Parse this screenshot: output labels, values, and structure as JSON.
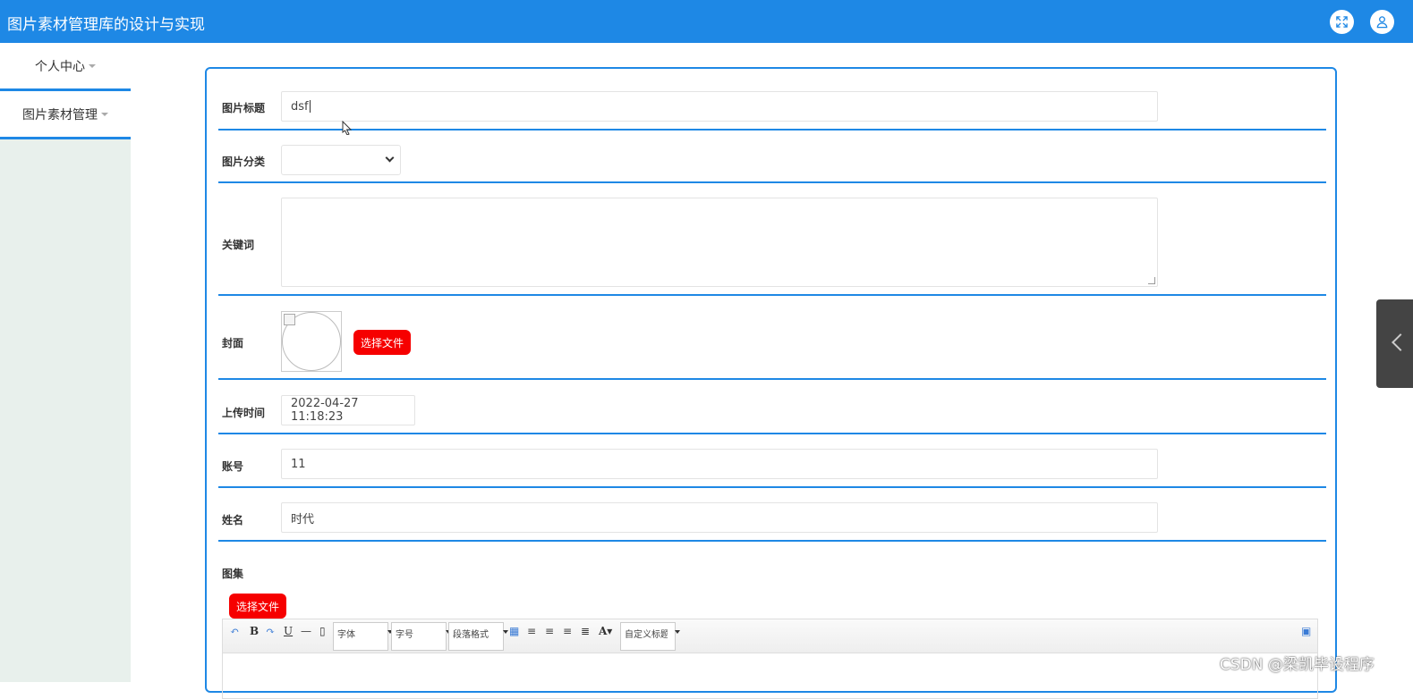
{
  "header": {
    "title": "图片素材管理库的设计与实现",
    "fullscreen_icon": "expand-icon",
    "user_icon": "user-icon"
  },
  "sidebar": {
    "items": [
      {
        "label": "个人中心"
      },
      {
        "label": "图片素材管理"
      }
    ]
  },
  "form": {
    "title_label": "图片标题",
    "title_value": "dsf",
    "category_label": "图片分类",
    "category_value": "",
    "keywords_label": "关键词",
    "cover_label": "封面",
    "cover_button": "选择文件",
    "upload_time_label": "上传时间",
    "upload_time_value": "2022-04-27 11:18:23",
    "account_label": "账号",
    "account_value": "11",
    "name_label": "姓名",
    "name_value": "时代",
    "gallery_label": "图集",
    "gallery_button": "选择文件"
  },
  "editor": {
    "font_combo": "字体",
    "size_combo": "字号",
    "paragraph_combo": "段落格式",
    "custom_title_combo": "自定义标题"
  },
  "watermark": "CSDN @梁凯毕设程序",
  "colors": {
    "primary": "#1e88e5",
    "danger": "#f60000",
    "sidebar_bg": "#e8f0ec"
  }
}
